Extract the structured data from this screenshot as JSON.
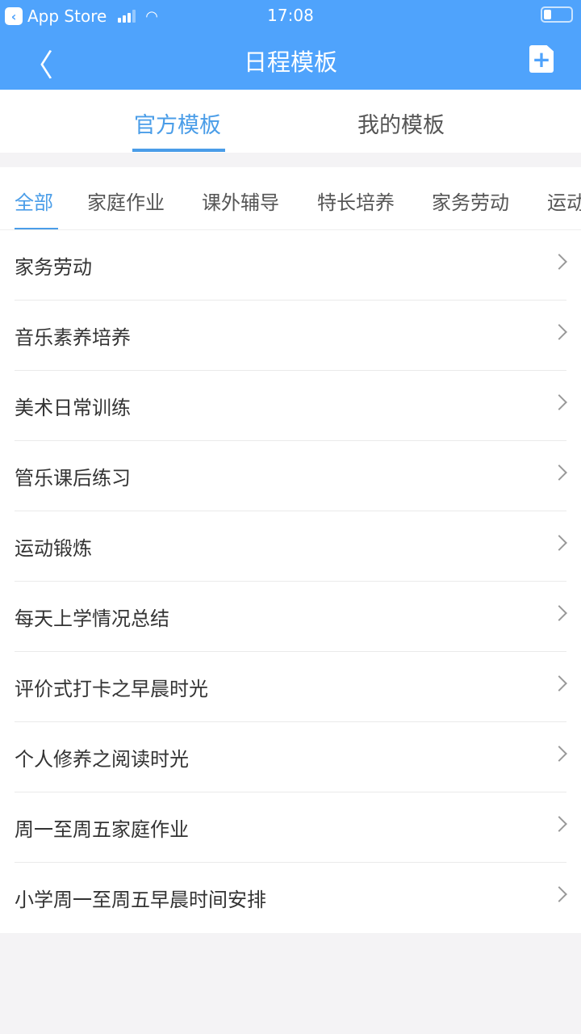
{
  "status_bar": {
    "back_app": "App Store",
    "time": "17:08",
    "battery_level": 0.25
  },
  "header": {
    "title": "日程模板"
  },
  "tabs": [
    {
      "label": "官方模板",
      "active": true
    },
    {
      "label": "我的模板",
      "active": false
    }
  ],
  "categories": [
    {
      "label": "全部",
      "active": true
    },
    {
      "label": "家庭作业"
    },
    {
      "label": "课外辅导"
    },
    {
      "label": "特长培养"
    },
    {
      "label": "家务劳动"
    },
    {
      "label": "运动"
    }
  ],
  "items": [
    {
      "label": "家务劳动"
    },
    {
      "label": "音乐素养培养"
    },
    {
      "label": "美术日常训练"
    },
    {
      "label": "管乐课后练习"
    },
    {
      "label": "运动锻炼"
    },
    {
      "label": "每天上学情况总结"
    },
    {
      "label": "评价式打卡之早晨时光"
    },
    {
      "label": "个人修养之阅读时光"
    },
    {
      "label": "周一至周五家庭作业"
    },
    {
      "label": "小学周一至周五早晨时间安排"
    }
  ],
  "colors": {
    "header": "#4fa3fc",
    "accent": "#4a9de8"
  }
}
